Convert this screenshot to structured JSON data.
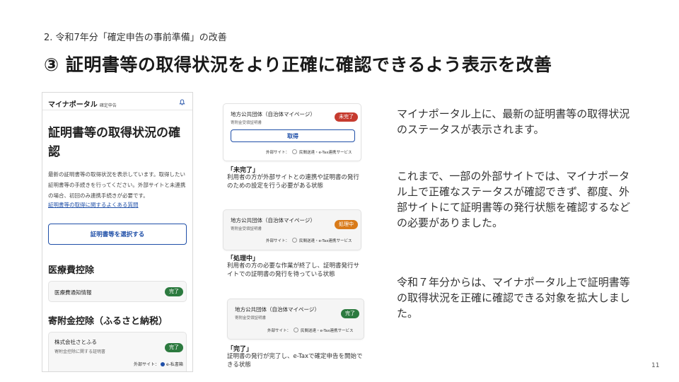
{
  "slide": {
    "section_label": "2. 令和7年分「確定申告の事前準備」の改善",
    "title": "③ 証明書等の取得状況をより正確に確認できるよう表示を改善",
    "page_number": "11"
  },
  "phone": {
    "app_name": "マイナポータル",
    "app_sub": "確定申告",
    "heading": "証明書等の取得状況の確認",
    "description": "最新の証明書等の取得状況を表示しています。取得したい証明書等の手続きを行ってください。外部サイトと未連携の場合、初回のみ連携手続きが必要です。",
    "faq_link": "証明書等の取得に関するよくある質問",
    "select_button": "証明書等を選択する",
    "medical_heading": "医療費控除",
    "medical_item": "医療費通知情報",
    "medical_status": "完了",
    "donation_heading": "寄附金控除（ふるさと納税）",
    "donation_item_name": "株式会社さとふる",
    "donation_item_sub": "寄附金控除に関する証明書",
    "donation_status": "完了",
    "donation_ext_label": "外部サイト：",
    "donation_ext_name": "e-私書箱"
  },
  "cards": [
    {
      "name": "地方公共団体（自治体マイページ）",
      "sub": "寄附金受領証明書",
      "badge": "未完了",
      "button": "取得",
      "ext_label": "外部サイト：",
      "ext_name": "民間送達・e-Tax連携サービス",
      "status_title": "「未完了」",
      "status_desc": "利用者の方が外部サイトとの連携や証明書の発行のための設定を行う必要がある状態"
    },
    {
      "name": "地方公共団体（自治体マイページ）",
      "sub": "寄附金受領証明書",
      "badge": "処理中",
      "ext_label": "外部サイト：",
      "ext_name": "民間送達・e-Tax連携サービス",
      "status_title": "「処理中」",
      "status_desc": "利用者の方の必要な作業が終了し、証明書発行サイトでの証明書の発行を待っている状態"
    },
    {
      "name": "地方公共団体（自治体マイページ）",
      "sub": "寄附金受領証明書",
      "badge": "完了",
      "ext_label": "外部サイト：",
      "ext_name": "民間送達・e-Tax連携サービス",
      "status_title": "「完了」",
      "status_desc": "証明書の発行が完了し、e-Taxで確定申告を開始できる状態"
    }
  ],
  "right_text": {
    "para1": "マイナポータル上に、最新の証明書等の取得状況のステータスが表示されます。",
    "para2": "これまで、一部の外部サイトでは、マイナポータル上で正確なステータスが確認できず、都度、外部サイトにて証明書等の発行状態を確認するなどの必要がありました。",
    "para3": "令和７年分からは、マイナポータル上で証明書等の取得状況を正確に確認できる対象を拡大しました。"
  },
  "colors": {
    "accent_blue": "#1f4fa8",
    "status_complete": "#2c7a3f",
    "status_incomplete": "#c63b2f",
    "status_processing": "#d97b1a"
  }
}
